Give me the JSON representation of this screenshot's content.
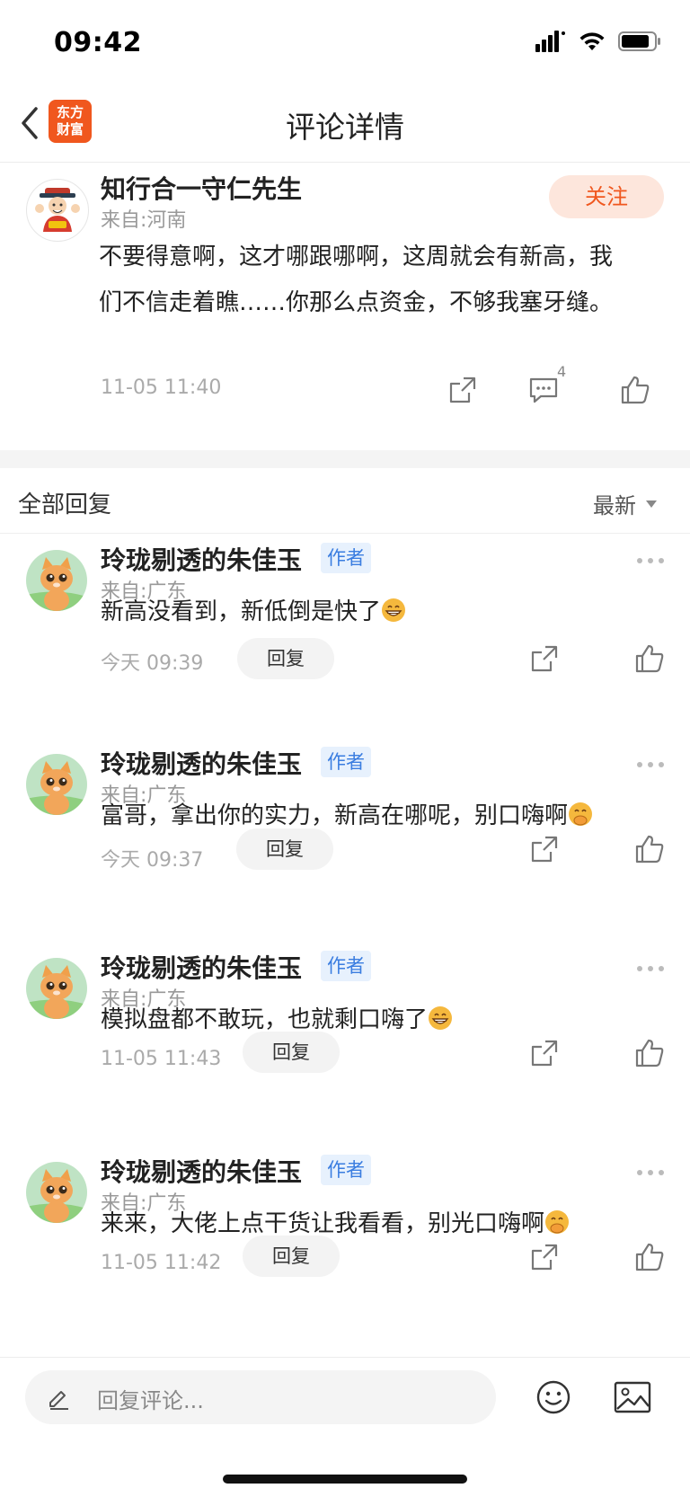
{
  "status_bar": {
    "time": "09:42"
  },
  "nav": {
    "title": "评论详情",
    "logo_line1": "东方",
    "logo_line2": "财富"
  },
  "main_comment": {
    "username": "知行合一守仁先生",
    "location": "来自:河南",
    "follow_label": "关注",
    "content": "不要得意啊，这才哪跟哪啊，这周就会有新高，我们不信走着瞧……你那么点资金，不够我塞牙缝。",
    "time": "11-05 11:40",
    "comment_count": "4"
  },
  "replies_header": {
    "title": "全部回复",
    "sort_label": "最新"
  },
  "replies": [
    {
      "username": "玲珑剔透的朱佳玉",
      "badge": "作者",
      "location": "来自:广东",
      "text": "新高没看到，新低倒是快了",
      "emoji": "grinning-face",
      "time": "今天 09:39",
      "reply_label": "回复"
    },
    {
      "username": "玲珑剔透的朱佳玉",
      "badge": "作者",
      "location": "来自:广东",
      "text": "富哥，拿出你的实力，新高在哪呢，别口嗨啊",
      "emoji": "hand-over-mouth-face",
      "time": "今天 09:37",
      "reply_label": "回复"
    },
    {
      "username": "玲珑剔透的朱佳玉",
      "badge": "作者",
      "location": "来自:广东",
      "text": "模拟盘都不敢玩，也就剩口嗨了",
      "emoji": "grinning-face",
      "time": "11-05 11:43",
      "reply_label": "回复"
    },
    {
      "username": "玲珑剔透的朱佳玉",
      "badge": "作者",
      "location": "来自:广东",
      "text": "来来，大佬上点干货让我看看，别光口嗨啊",
      "emoji": "hand-over-mouth-face",
      "time": "11-05 11:42",
      "reply_label": "回复"
    }
  ],
  "bottom_bar": {
    "reply_placeholder": "回复评论..."
  },
  "colors": {
    "accent": "#f0571e",
    "follow_bg": "#fde6dc",
    "author_badge_text": "#3a7de0",
    "author_badge_bg": "#e7f1fd"
  }
}
